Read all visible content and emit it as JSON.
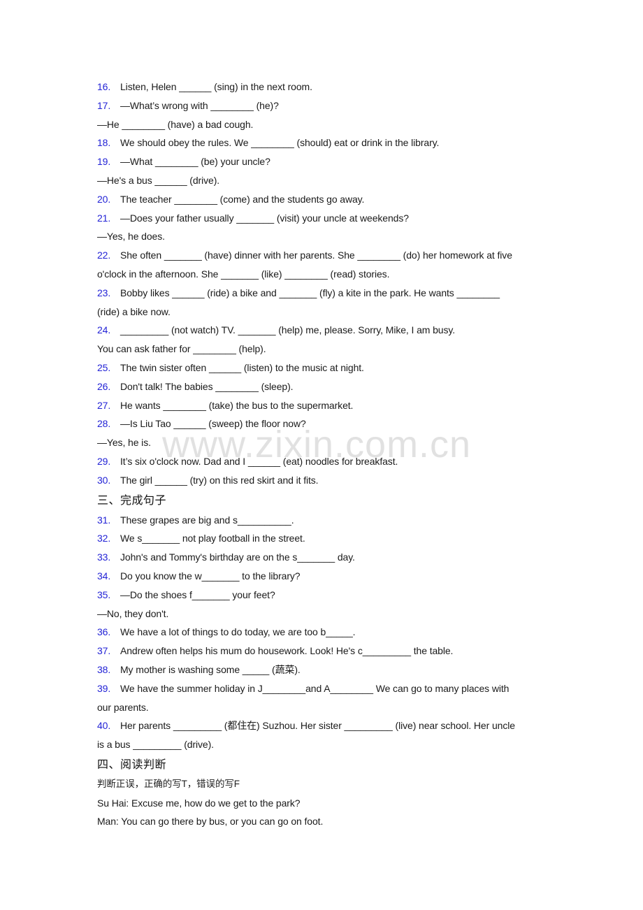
{
  "watermark": "www.zixin.com.cn",
  "section2_items": [
    {
      "num": "16.",
      "lines": [
        "Listen, Helen ______ (sing) in the next room."
      ]
    },
    {
      "num": "17.",
      "lines": [
        "—What’s wrong with ________ (he)?",
        "—He ________ (have) a bad cough."
      ]
    },
    {
      "num": "18.",
      "lines": [
        "We should obey the rules. We ________ (should) eat or drink in the library."
      ]
    },
    {
      "num": "19.",
      "lines": [
        "—What ________ (be) your uncle?",
        "—He's a bus ______ (drive)."
      ]
    },
    {
      "num": "20.",
      "lines": [
        "The teacher ________ (come) and the students go away."
      ]
    },
    {
      "num": "21.",
      "lines": [
        "—Does your father usually _______ (visit) your uncle at weekends?",
        "—Yes, he does."
      ]
    },
    {
      "num": "22.",
      "lines": [
        "She often _______ (have) dinner with her parents. She ________ (do) her homework at five",
        "o'clock in the afternoon. She _______ (like) ________ (read) stories."
      ]
    },
    {
      "num": "23.",
      "lines": [
        "Bobby likes ______ (ride) a bike and _______ (fly) a kite in the park. He wants ________",
        "(ride) a bike now."
      ]
    },
    {
      "num": "24.",
      "lines": [
        "_________ (not watch) TV. _______ (help) me, please. Sorry, Mike, I am busy.",
        "You can ask father for ________ (help)."
      ]
    },
    {
      "num": "25.",
      "lines": [
        "The twin sister often ______ (listen) to the music at night."
      ]
    },
    {
      "num": "26.",
      "lines": [
        "Don't talk! The babies ________ (sleep)."
      ]
    },
    {
      "num": "27.",
      "lines": [
        "He wants ________ (take) the bus to the supermarket."
      ]
    },
    {
      "num": "28.",
      "lines": [
        "—Is Liu Tao ______ (sweep) the floor now?",
        "—Yes, he is."
      ]
    },
    {
      "num": "29.",
      "lines": [
        "It’s six o'clock now. Dad and I ______ (eat) noodles for breakfast."
      ]
    },
    {
      "num": "30.",
      "lines": [
        "The girl ______ (try) on this red skirt and it fits."
      ]
    }
  ],
  "section3": {
    "heading": "三、完成句子",
    "items": [
      {
        "num": "31.",
        "lines": [
          "These grapes are big and s__________."
        ]
      },
      {
        "num": "32.",
        "lines": [
          "We s_______ not play football in the street."
        ]
      },
      {
        "num": "33.",
        "lines": [
          "John's and Tommy's birthday are on the s_______ day."
        ]
      },
      {
        "num": "34.",
        "lines": [
          "Do you know the w_______ to the library?"
        ]
      },
      {
        "num": "35.",
        "lines": [
          "—Do the shoes f_______ your feet?",
          "—No, they don't."
        ]
      },
      {
        "num": "36.",
        "lines": [
          "We have a lot of things to do today, we are too b_____."
        ]
      },
      {
        "num": "37.",
        "lines": [
          "Andrew often helps his mum do housework. Look! He's c_________ the table."
        ]
      },
      {
        "num": "38.",
        "lines": [
          "My mother is washing some _____ (蔬菜)."
        ]
      },
      {
        "num": "39.",
        "lines": [
          "We have the summer holiday in J________and A________ We can go to many places with",
          "our parents."
        ]
      },
      {
        "num": "40.",
        "lines": [
          "Her parents _________ (都住在) Suzhou. Her sister _________ (live) near school. Her uncle",
          "is a bus _________ (drive)."
        ]
      }
    ]
  },
  "section4": {
    "heading": "四、阅读判断",
    "instruction": "判断正误，正确的写T，错误的写F",
    "dialogue": [
      "Su Hai: Excuse me, how do we get to the park?",
      "Man: You can go there by bus, or you can go on foot."
    ]
  },
  "colors": {
    "number": "#2323d6",
    "text": "#1a1a1a",
    "watermark": "#d8d8d8"
  }
}
